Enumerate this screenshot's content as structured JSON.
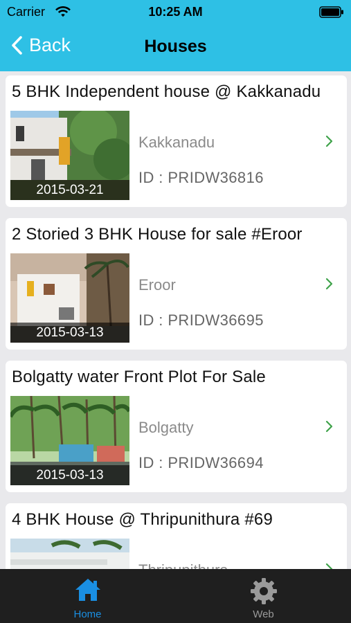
{
  "status_bar": {
    "carrier": "Carrier",
    "time": "10:25 AM"
  },
  "navbar": {
    "back_label": "Back",
    "title": "Houses"
  },
  "listings": [
    {
      "title": "5 BHK Independent house @ Kakkanadu",
      "location": "Kakkanadu",
      "id": "ID : PRIDW36816",
      "date": "2015-03-21"
    },
    {
      "title": "2 Storied  3 BHK House for sale #Eroor",
      "location": "Eroor",
      "id": "ID : PRIDW36695",
      "date": "2015-03-13"
    },
    {
      "title": "Bolgatty water Front Plot For Sale",
      "location": "Bolgatty",
      "id": "ID : PRIDW36694",
      "date": "2015-03-13"
    },
    {
      "title": "4  BHK House @ Thripunithura #69",
      "location": "Thripunithura",
      "id": "",
      "date": ""
    }
  ],
  "tabbar": {
    "tabs": [
      {
        "label": "Home",
        "icon": "home-icon",
        "active": true
      },
      {
        "label": "Web",
        "icon": "gear-icon",
        "active": false
      }
    ]
  },
  "colors": {
    "header": "#2ec0e5",
    "chevron": "#3fa24a",
    "tab_active": "#1a8fe3",
    "tab_inactive": "#9a9a9a",
    "tabbar": "#1f1f1f"
  }
}
